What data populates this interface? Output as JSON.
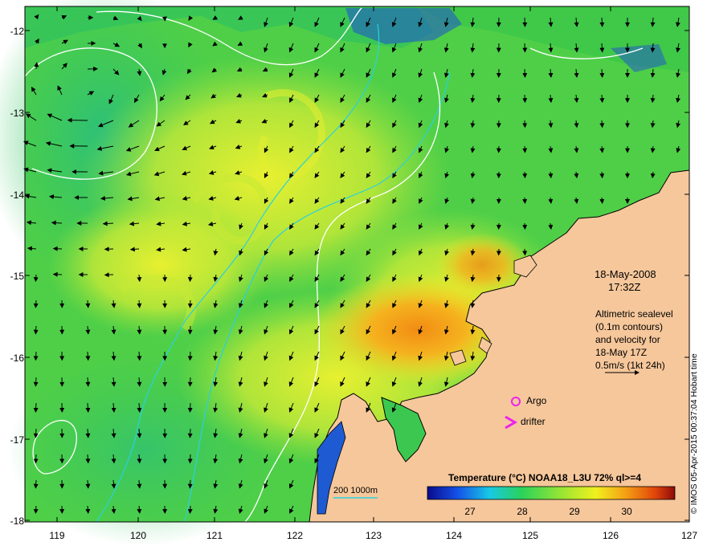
{
  "map": {
    "lat_labels": [
      "-12",
      "-13",
      "-14",
      "-15",
      "-16",
      "-17",
      "-18"
    ],
    "lon_labels": [
      "119",
      "120",
      "121",
      "122",
      "123",
      "124",
      "125",
      "126",
      "127"
    ],
    "date": "18-May-2008",
    "time": "17:32Z",
    "annotation_lines": [
      "Altimetric sealevel",
      "(0.1m contours)",
      "and velocity for",
      "18-May 17Z",
      "0.5m/s (1kt 24h)"
    ],
    "credit": "© IMOS 05-Apr-2015 00:37:04 Hobart time",
    "argo_label": "Argo",
    "drifter_label": "drifter",
    "scale_label": "200  1000m"
  },
  "colorbar": {
    "title": "Temperature (°C) NOAA18_L3U 72% ql>=4",
    "ticks": [
      "27",
      "28",
      "29",
      "30"
    ],
    "range": [
      26.3,
      31.0
    ]
  },
  "colors": {
    "land": "#f6c79b",
    "sea_base": "#5cd24a",
    "contour": "#ffffff",
    "bathymetry": "#2ad0e0",
    "marker": "#ee22ee"
  }
}
